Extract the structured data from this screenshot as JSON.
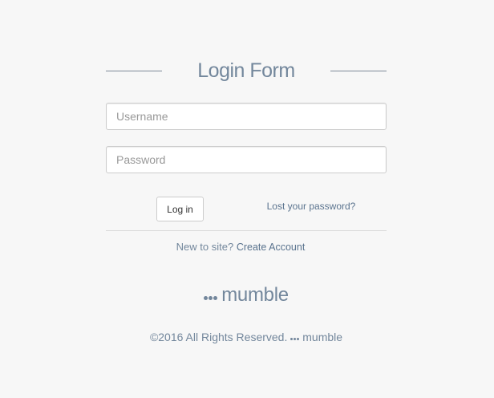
{
  "form": {
    "title": "Login Form",
    "username_placeholder": "Username",
    "password_placeholder": "Password",
    "login_button_label": "Log in",
    "lost_password_link": "Lost your password?"
  },
  "signup": {
    "prompt": "New to site?",
    "create_account_link": "Create Account"
  },
  "brand": {
    "name": "mumble",
    "icon": "three-dots-icon"
  },
  "footer": {
    "copyright": "©2016 All Rights Reserved.",
    "brand_name": "mumble",
    "icon": "three-dots-icon"
  },
  "colors": {
    "background": "#f7f7f7",
    "text": "#73879c",
    "link": "#5a738e",
    "border": "#cccccc"
  }
}
